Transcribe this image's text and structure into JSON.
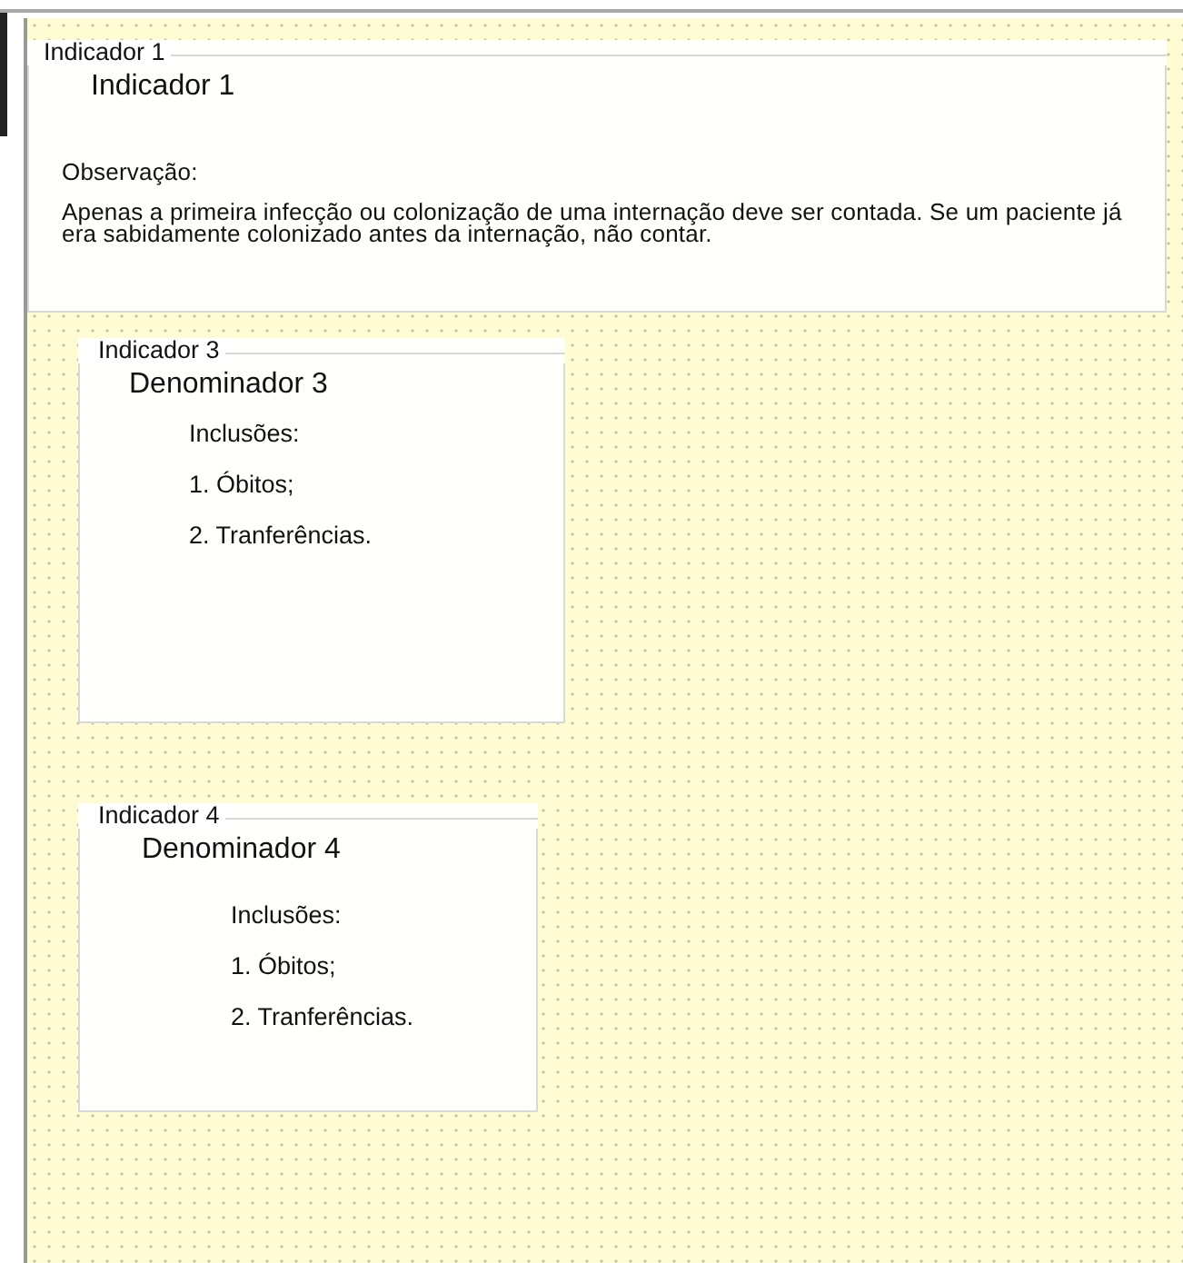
{
  "groups": [
    {
      "kind": "note",
      "legend": "Indicador 1",
      "heading": "Indicador 1",
      "lines": [
        "Observação:",
        "Apenas a primeira infecção ou colonização de uma internação deve ser contada. Se um paciente já era sabidamente colonizado antes da internação, não contar."
      ]
    },
    {
      "kind": "list",
      "legend": "Indicador 3",
      "heading": "Denominador 3",
      "lines": [
        "Inclusões:",
        "1. Óbitos;",
        "2. Tranferências."
      ]
    },
    {
      "kind": "list",
      "legend": "Indicador 4",
      "heading": "Denominador 4",
      "lines": [
        "Inclusões:",
        "1. Óbitos;",
        "2. Tranferências."
      ]
    }
  ]
}
